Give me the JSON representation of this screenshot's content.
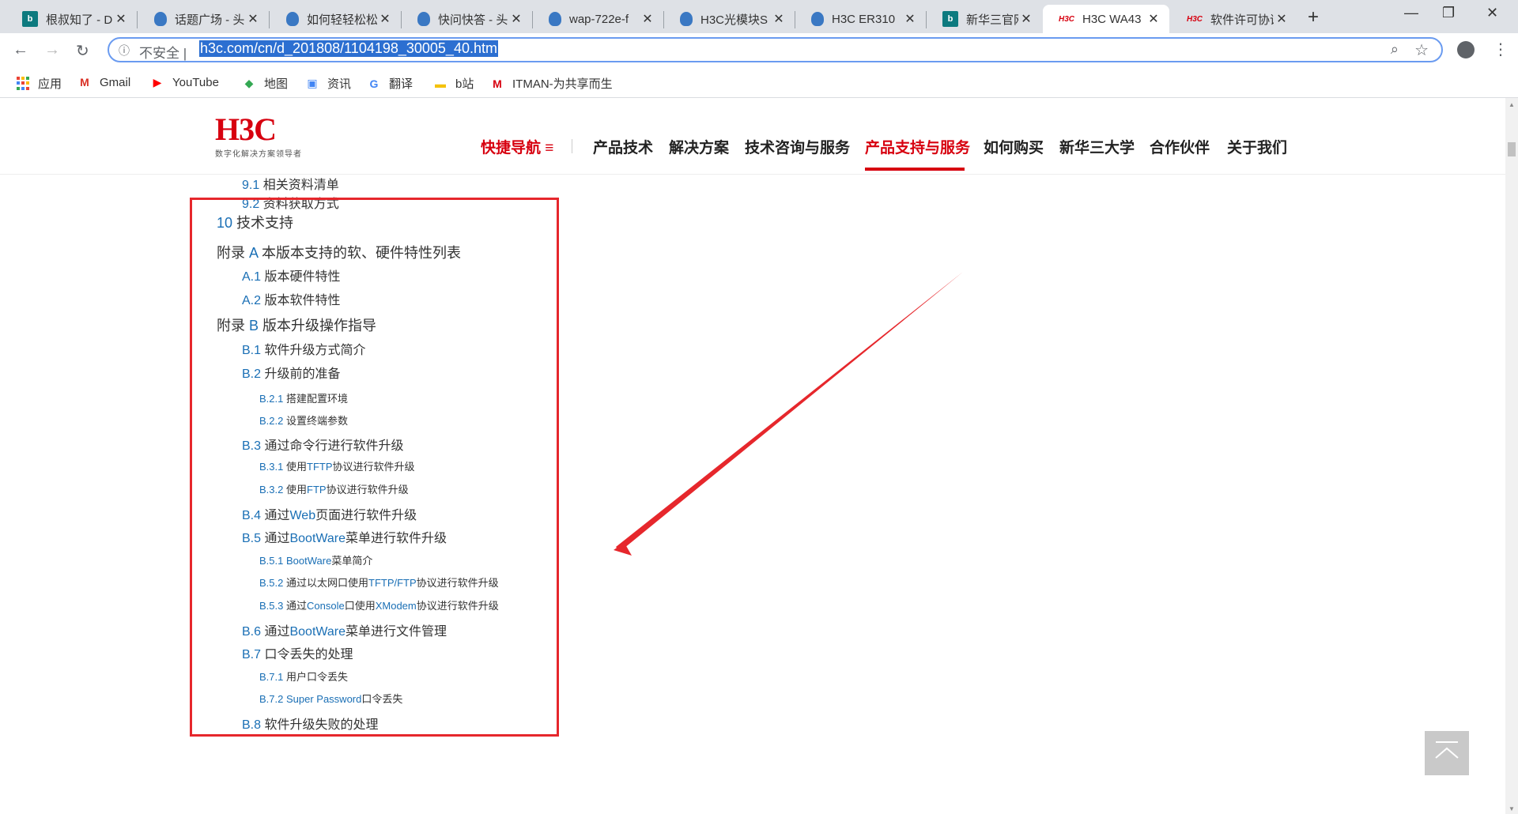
{
  "browser": {
    "tabs": [
      {
        "title": "根叔知了 - D",
        "icon": "bing-icon"
      },
      {
        "title": "话题广场 - 头",
        "icon": "droplet-icon"
      },
      {
        "title": "如何轻轻松松",
        "icon": "droplet-icon"
      },
      {
        "title": "快问快答 - 头",
        "icon": "droplet-icon"
      },
      {
        "title": "wap-722e-f",
        "icon": "droplet-icon"
      },
      {
        "title": "H3C光模块S",
        "icon": "droplet-icon"
      },
      {
        "title": "H3C ER310",
        "icon": "droplet-icon"
      },
      {
        "title": "新华三官网",
        "icon": "bing-icon"
      },
      {
        "title": "H3C WA43",
        "icon": "h3c-icon",
        "active": true
      },
      {
        "title": "软件许可协议",
        "icon": "h3c-icon"
      }
    ],
    "favicon_h3c": "H3C",
    "favicon_bing": "b",
    "new_tab": "+",
    "close_glyph": "✕",
    "window": {
      "minimize": "—",
      "restore": "❐",
      "close": "✕"
    },
    "nav": {
      "back": "←",
      "forward": "→",
      "reload": "↻"
    },
    "address": {
      "security": "不安全",
      "separator": "|",
      "url": "h3c.com/cn/d_201808/1104198_30005_40.htm"
    },
    "menu_glyph": "⋮",
    "bookmarks": [
      {
        "label": "应用",
        "icon": "apps-icon"
      },
      {
        "label": "Gmail",
        "icon": "gmail-icon",
        "glyph": "M",
        "color": "#d93025"
      },
      {
        "label": "YouTube",
        "icon": "youtube-icon",
        "glyph": "▶",
        "color": "#ff0000"
      },
      {
        "label": "地图",
        "icon": "maps-icon",
        "glyph": "◆",
        "color": "#34a853"
      },
      {
        "label": "资讯",
        "icon": "news-icon",
        "glyph": "▣",
        "color": "#4285f4"
      },
      {
        "label": "翻译",
        "icon": "translate-icon",
        "glyph": "G",
        "color": "#4285f4"
      },
      {
        "label": "b站",
        "icon": "folder-icon",
        "glyph": "▬",
        "color": "#f4c20d"
      },
      {
        "label": "ITMAN-为共享而生",
        "icon": "itman-icon",
        "glyph": "M",
        "color": "#d7000f"
      }
    ]
  },
  "site": {
    "logo": "H3C",
    "slogan": "数字化解决方案领导者",
    "nav": [
      {
        "label": "快捷导航",
        "red": true,
        "icon": "menu-icon"
      },
      {
        "label": "产品技术"
      },
      {
        "label": "解决方案"
      },
      {
        "label": "技术咨询与服务"
      },
      {
        "label": "产品支持与服务",
        "red": true,
        "active": true
      },
      {
        "label": "如何购买"
      },
      {
        "label": "新华三大学"
      },
      {
        "label": "合作伙伴"
      },
      {
        "label": "关于我们"
      }
    ]
  },
  "toc": [
    {
      "num": "9.1",
      "text": "相关资料清单",
      "level": 2,
      "partial": true
    },
    {
      "num": "9.2",
      "text": "资料获取方式",
      "level": 2
    },
    {
      "num": "10",
      "text": "技术支持",
      "level": 1
    },
    {
      "prefix": "附录",
      "num": "A",
      "text": "本版本支持的软、硬件特性列表",
      "level": 1
    },
    {
      "num": "A.1",
      "text": "版本硬件特性",
      "level": 2
    },
    {
      "num": "A.2",
      "text": "版本软件特性",
      "level": 2
    },
    {
      "prefix": "附录",
      "num": "B",
      "text": "版本升级操作指导",
      "level": 1
    },
    {
      "num": "B.1",
      "text": "软件升级方式简介",
      "level": 2
    },
    {
      "num": "B.2",
      "text": "升级前的准备",
      "level": 2
    },
    {
      "num": "B.2.1",
      "text": "搭建配置环境",
      "level": 3
    },
    {
      "num": "B.2.2",
      "text": "设置终端参数",
      "level": 3
    },
    {
      "num": "B.3",
      "text": "通过命令行进行软件升级",
      "level": 2
    },
    {
      "num": "B.3.1",
      "text": "使用TFTP协议进行软件升级",
      "level": 3
    },
    {
      "num": "B.3.2",
      "text": "使用FTP协议进行软件升级",
      "level": 3
    },
    {
      "num": "B.4",
      "text": "通过Web页面进行软件升级",
      "level": 2
    },
    {
      "num": "B.5",
      "text": "通过BootWare菜单进行软件升级",
      "level": 2
    },
    {
      "num": "B.5.1",
      "text": "BootWare菜单简介",
      "level": 3
    },
    {
      "num": "B.5.2",
      "text": "通过以太网口使用TFTP/FTP协议进行软件升级",
      "level": 3
    },
    {
      "num": "B.5.3",
      "text": "通过Console口使用XModem协议进行软件升级",
      "level": 3
    },
    {
      "num": "B.6",
      "text": "通过BootWare菜单进行文件管理",
      "level": 2
    },
    {
      "num": "B.7",
      "text": "口令丢失的处理",
      "level": 2
    },
    {
      "num": "B.7.1",
      "text": "用户口令丢失",
      "level": 3
    },
    {
      "num": "B.7.2",
      "text": "Super Password口令丢失",
      "level": 3
    },
    {
      "num": "B.8",
      "text": "软件升级失败的处理",
      "level": 2
    }
  ],
  "colors": {
    "brand": "#d7000f",
    "link": "#1a6fb5",
    "annotation": "#e6272c"
  }
}
